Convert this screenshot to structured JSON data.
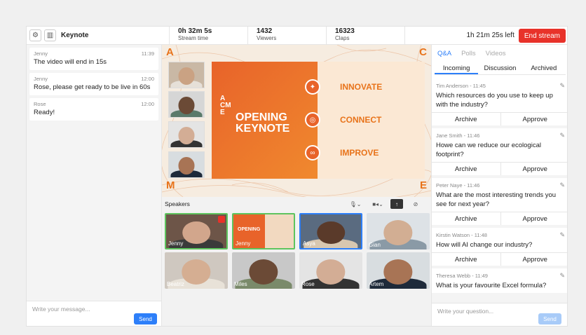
{
  "header": {
    "title": "Keynote",
    "stats": [
      {
        "value": "0h 32m 5s",
        "label": "Stream time"
      },
      {
        "value": "1432",
        "label": "Viewers"
      },
      {
        "value": "16323",
        "label": "Claps"
      }
    ],
    "time_left": "1h 21m 25s left",
    "end_label": "End stream"
  },
  "chat": {
    "messages": [
      {
        "author": "Jenny",
        "time": "11:39",
        "text": "The video will end in 15s"
      },
      {
        "author": "Jenny",
        "time": "12:00",
        "text": "Rose, please get ready to be live in 60s"
      },
      {
        "author": "Rose",
        "time": "12:00",
        "text": "Ready!"
      }
    ],
    "placeholder": "Write your message...",
    "send_label": "Send"
  },
  "stage": {
    "corners": [
      "A",
      "C",
      "M",
      "E"
    ],
    "slide": {
      "acme": "A CM E",
      "title": "OPENING KEYNOTE",
      "points": [
        "INNOVATE",
        "CONNECT",
        "IMPROVE"
      ]
    }
  },
  "speakers": {
    "label": "Speakers",
    "tiles": [
      {
        "name": "Jenny"
      },
      {
        "name": "Jenny"
      },
      {
        "name": "Asya"
      },
      {
        "name": "Gian"
      },
      {
        "name": "Beatriz"
      },
      {
        "name": "Miles"
      },
      {
        "name": "Rose"
      },
      {
        "name": "Artem"
      }
    ]
  },
  "qa": {
    "tabs": [
      "Q&A",
      "Polls",
      "Videos"
    ],
    "subtabs": [
      "Incoming",
      "Discussion",
      "Archived"
    ],
    "questions": [
      {
        "author": "Tim Anderson",
        "time": "11:45",
        "text": "Which resources do you use to keep up with the industry?"
      },
      {
        "author": "Jane Smith",
        "time": "11:46",
        "text": "Howe can we reduce our ecological footprint?"
      },
      {
        "author": "Peter Naye",
        "time": "11:46",
        "text": "What are the most interesting trends you see for next year?"
      },
      {
        "author": "Kirstin Watson",
        "time": "11:48",
        "text": "How will AI change our industry?"
      },
      {
        "author": "Theresa Webb",
        "time": "11:49",
        "text": "What is your favourite Excel formula?"
      }
    ],
    "archive_label": "Archive",
    "approve_label": "Approve",
    "placeholder": "Write your question...",
    "send_label": "Send"
  },
  "colors": {
    "accent": "#2d7ff9",
    "danger": "#e8322a",
    "brand": "#e8731a"
  }
}
